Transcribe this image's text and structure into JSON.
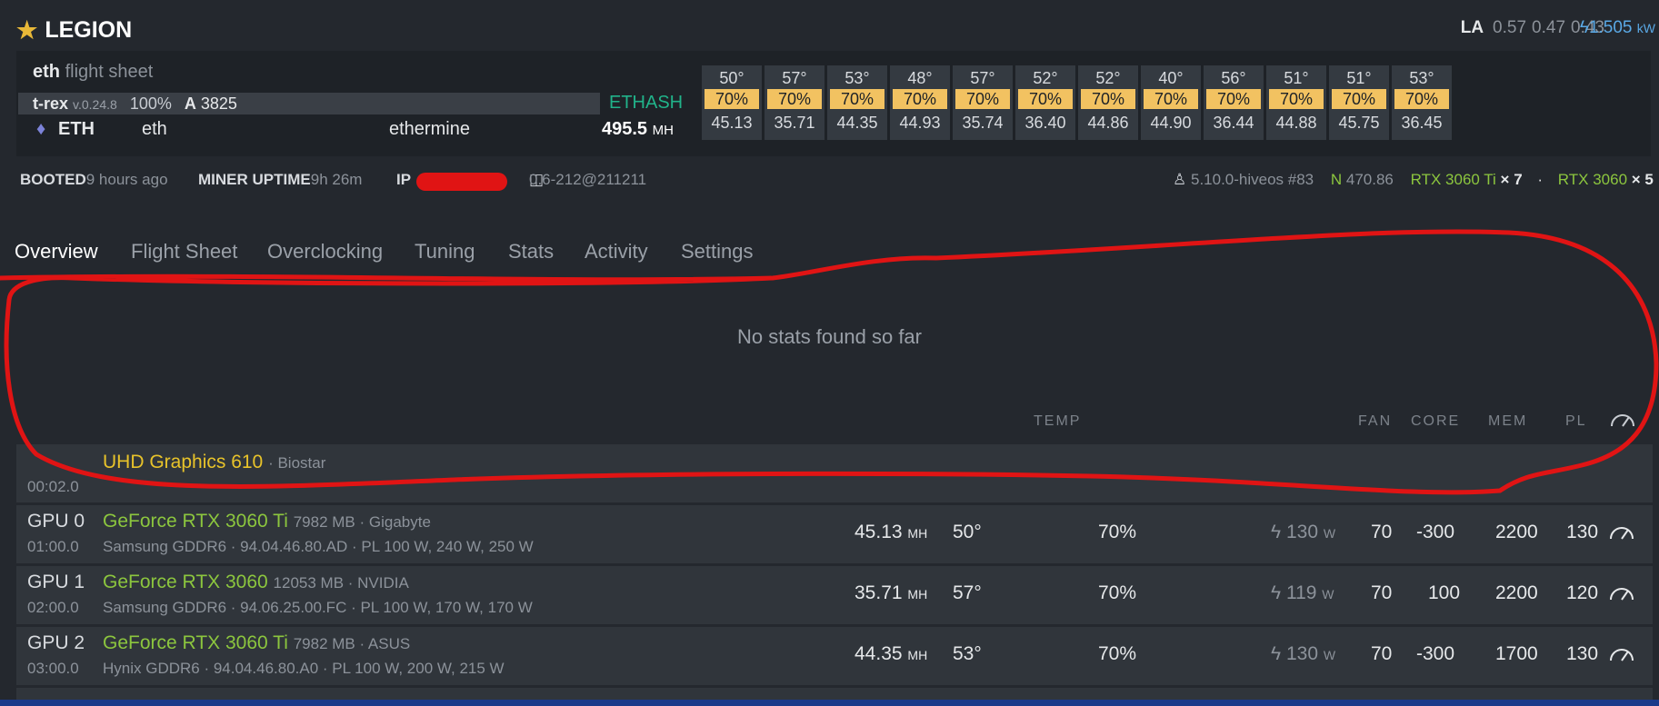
{
  "header": {
    "rig_name": "LEGION",
    "la_label": "LA",
    "la_values": [
      "0.57",
      "0.47",
      "0.43"
    ],
    "power_value": "1.505",
    "power_unit": "kW"
  },
  "flight_sheet": {
    "name": "eth",
    "suffix": "flight sheet",
    "miner": "t-rex",
    "miner_version": "v.0.24.8",
    "percent": "100%",
    "a_label": "A",
    "a_value": "3825",
    "algo": "ETHASH",
    "coin": "ETH",
    "wallet": "eth",
    "pool": "ethermine",
    "hashrate": "495.5",
    "hashrate_unit": "MH"
  },
  "gpu_tiles": [
    {
      "temp": "50°",
      "fan": "70%",
      "hash": "45.13"
    },
    {
      "temp": "57°",
      "fan": "70%",
      "hash": "35.71"
    },
    {
      "temp": "53°",
      "fan": "70%",
      "hash": "44.35"
    },
    {
      "temp": "48°",
      "fan": "70%",
      "hash": "44.93"
    },
    {
      "temp": "57°",
      "fan": "70%",
      "hash": "35.74"
    },
    {
      "temp": "52°",
      "fan": "70%",
      "hash": "36.40"
    },
    {
      "temp": "52°",
      "fan": "70%",
      "hash": "44.86"
    },
    {
      "temp": "40°",
      "fan": "70%",
      "hash": "44.90"
    },
    {
      "temp": "56°",
      "fan": "70%",
      "hash": "36.44"
    },
    {
      "temp": "51°",
      "fan": "70%",
      "hash": "44.88"
    },
    {
      "temp": "51°",
      "fan": "70%",
      "hash": "45.75"
    },
    {
      "temp": "53°",
      "fan": "70%",
      "hash": "36.45"
    }
  ],
  "info": {
    "booted_label": "BOOTED",
    "booted_value": "9 hours ago",
    "uptime_label": "MINER UPTIME",
    "uptime_value": "9h 26m",
    "ip_label": "IP",
    "version": "0.6-212@211211",
    "kernel": "5.10.0-hiveos #83",
    "n_label": "N",
    "n_value": "470.86",
    "gpu_model_a": "RTX 3060 Ti",
    "gpu_count_a": "× 7",
    "separator": "·",
    "gpu_model_b": "RTX 3060",
    "gpu_count_b": "× 5"
  },
  "tabs": [
    "Overview",
    "Flight Sheet",
    "Overclocking",
    "Tuning",
    "Stats",
    "Activity",
    "Settings"
  ],
  "empty_message": "No stats found so far",
  "columns": {
    "temp": "TEMP",
    "fan": "FAN",
    "core": "CORE",
    "mem": "MEM",
    "pl": "PL"
  },
  "igpu": {
    "bus": "00:02.0",
    "model": "UHD Graphics 610",
    "vendor": "· Biostar"
  },
  "gpus": [
    {
      "name": "GPU 0",
      "bus": "01:00.0",
      "model": "GeForce RTX 3060 Ti",
      "vram": "7982 MB · Gigabyte",
      "mem": "Samsung GDDR6 · 94.04.46.80.AD · PL 100 W, 240 W, 250 W",
      "hash": "45.13",
      "unit": "MH",
      "temp": "50°",
      "fan": "70%",
      "watt": "130",
      "watt_unit": "W",
      "fan_set": "70",
      "core": "-300",
      "memclk": "2200",
      "pl": "130"
    },
    {
      "name": "GPU 1",
      "bus": "02:00.0",
      "model": "GeForce RTX 3060",
      "vram": "12053 MB · NVIDIA",
      "mem": "Samsung GDDR6 · 94.06.25.00.FC · PL 100 W, 170 W, 170 W",
      "hash": "35.71",
      "unit": "MH",
      "temp": "57°",
      "fan": "70%",
      "watt": "119",
      "watt_unit": "W",
      "fan_set": "70",
      "core": "100",
      "memclk": "2200",
      "pl": "120"
    },
    {
      "name": "GPU 2",
      "bus": "03:00.0",
      "model": "GeForce RTX 3060 Ti",
      "vram": "7982 MB · ASUS",
      "mem": "Hynix GDDR6 · 94.04.46.80.A0 · PL 100 W, 200 W, 215 W",
      "hash": "44.35",
      "unit": "MH",
      "temp": "53°",
      "fan": "70%",
      "watt": "130",
      "watt_unit": "W",
      "fan_set": "70",
      "core": "-300",
      "memclk": "1700",
      "pl": "130"
    }
  ]
}
